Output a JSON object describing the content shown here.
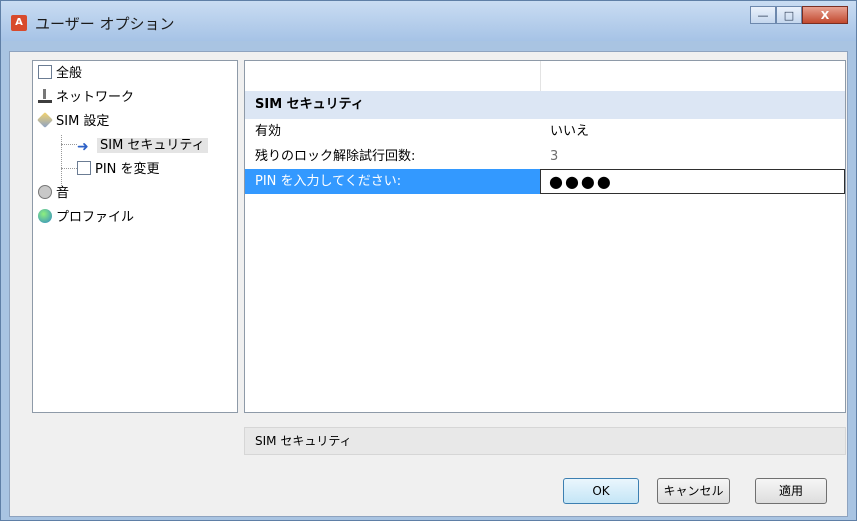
{
  "window": {
    "title": "ユーザー オプション",
    "buttons": {
      "minimize": "—",
      "maximize": "□",
      "close": "X"
    }
  },
  "tree": {
    "items": [
      {
        "label": "全般",
        "icon": "general-page-icon"
      },
      {
        "label": "ネットワーク",
        "icon": "network-icon"
      },
      {
        "label": "SIM 設定",
        "icon": "sim-icon"
      },
      {
        "label": "SIM セキュリティ",
        "icon": "arrow-right-icon",
        "selected": true
      },
      {
        "label": "PIN を変更",
        "icon": "pin-page-icon"
      },
      {
        "label": "音",
        "icon": "sound-icon"
      },
      {
        "label": "プロファイル",
        "icon": "profile-icon"
      }
    ]
  },
  "grid": {
    "section_title": "SIM セキュリティ",
    "rows": [
      {
        "label": "有効",
        "value": "いいえ"
      },
      {
        "label": "残りのロック解除試行回数:",
        "value": "3"
      },
      {
        "label": "PIN を入力してください:",
        "value": "●●●●"
      }
    ]
  },
  "description": "SIM セキュリティ",
  "actions": {
    "ok": "OK",
    "cancel": "キャンセル",
    "apply": "適用"
  },
  "colors": {
    "selection": "#3399ff",
    "section_background": "#dce6f4",
    "window_frame": "#a9c4e2"
  }
}
